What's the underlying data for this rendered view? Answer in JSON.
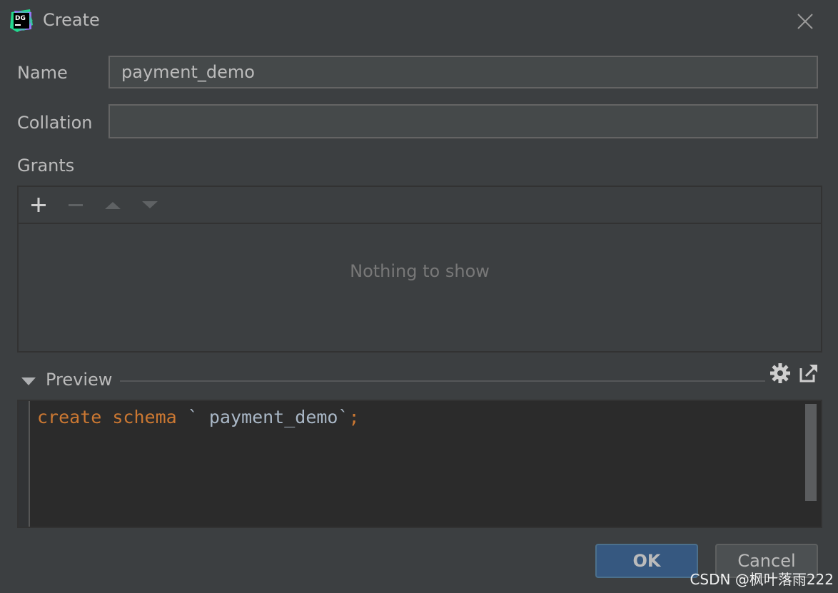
{
  "window": {
    "title": "Create",
    "app_icon": "datagrip-logo-icon",
    "close_icon": "close-icon"
  },
  "form": {
    "name_label": "Name",
    "name_value": "payment_demo",
    "collation_label": "Collation",
    "collation_value": "",
    "grants_label": "Grants"
  },
  "grants": {
    "toolbar": [
      "plus-icon",
      "minus-icon",
      "move-up-icon",
      "move-down-icon"
    ],
    "empty_text": "Nothing to show"
  },
  "preview": {
    "label": "Preview",
    "expanded": true,
    "code": {
      "keyword1": "create",
      "keyword2": "schema",
      "backtick_open": "`",
      "identifier": " payment_demo",
      "backtick_close": "`",
      "terminator": ";"
    },
    "settings_icon": "gear-icon",
    "open_icon": "open-external-icon"
  },
  "buttons": {
    "ok": "OK",
    "cancel": "Cancel"
  },
  "watermark": "CSDN @枫叶落雨222",
  "colors": {
    "background": "#3c3f41",
    "editor_background": "#2b2b2b",
    "keyword": "#cc7832",
    "identifier": "#a9b7c6",
    "ok_button": "#365880"
  }
}
